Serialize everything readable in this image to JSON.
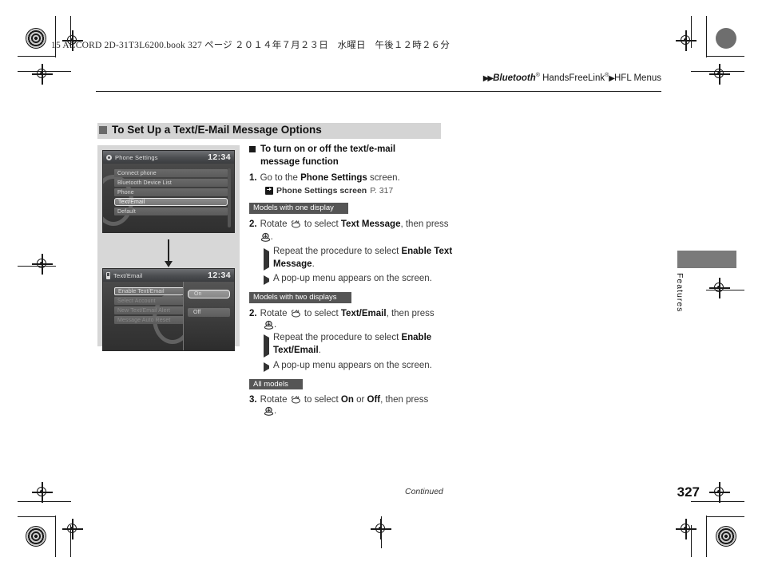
{
  "print_slug": "15 ACCORD 2D-31T3L6200.book  327 ページ  ２０１４年７月２３日　水曜日　午後１２時２６分",
  "breadcrumb": {
    "arrows": "▶▶",
    "item1": "Bluetooth",
    "sup1": "®",
    "item2": "HandsFreeLink",
    "sup2": "®",
    "arrow_mid": "▶",
    "item3": "HFL Menus"
  },
  "section": {
    "title": "To Set Up a Text/E-Mail Message Options"
  },
  "screens": [
    {
      "title": "Phone Settings",
      "icon": "gear-icon",
      "clock": "12:34",
      "items": [
        {
          "label": "Connect phone",
          "state": "normal"
        },
        {
          "label": "Bluetooth Device List",
          "state": "normal"
        },
        {
          "label": "Phone",
          "state": "normal"
        },
        {
          "label": "Text/Email",
          "state": "selected"
        },
        {
          "label": "Default",
          "state": "normal"
        }
      ]
    },
    {
      "title": "Text/Email",
      "icon": "phone-icon",
      "clock": "12:34",
      "items": [
        {
          "label": "Enable Text/Email",
          "state": "highlighted"
        },
        {
          "label": "Select Account",
          "state": "dim"
        },
        {
          "label": "New Text/Email Alert",
          "state": "dim"
        },
        {
          "label": "Message Auto Reset",
          "state": "dim"
        }
      ],
      "popup": [
        {
          "label": "On",
          "state": "selected"
        },
        {
          "label": "Off",
          "state": "normal"
        }
      ]
    }
  ],
  "instructions": {
    "subhead_line1": "To turn on or off the text/e-mail",
    "subhead_line2": "message function",
    "step1": {
      "num": "1.",
      "text_a": "Go to the ",
      "bold_a": "Phone Settings",
      "text_b": " screen."
    },
    "reference": {
      "label": "Phone Settings screen",
      "page": "P. 317"
    },
    "group_one_display": {
      "tag": "Models with one display",
      "step": {
        "num": "2.",
        "text_a": "Rotate ",
        "icon_knob": "rotary-knob-icon",
        "text_b": " to select ",
        "bold_a": "Text Message",
        "text_c": ", then press ",
        "icon_enter": "enter-button-icon",
        "text_d": "."
      },
      "bullets": [
        {
          "text_a": "Repeat the procedure to select ",
          "bold_a": "Enable Text Message",
          "text_b": "."
        },
        {
          "text_a": "A pop-up menu appears on the screen.",
          "bold_a": "",
          "text_b": ""
        }
      ]
    },
    "group_two_displays": {
      "tag": "Models with two displays",
      "step": {
        "num": "2.",
        "text_a": "Rotate ",
        "icon_knob": "rotary-knob-icon",
        "text_b": " to select ",
        "bold_a": "Text/Email",
        "text_c": ", then press ",
        "icon_enter": "enter-button-icon",
        "text_d": "."
      },
      "bullets": [
        {
          "text_a": "Repeat the procedure to select ",
          "bold_a": "Enable Text/Email",
          "text_b": "."
        },
        {
          "text_a": "A pop-up menu appears on the screen.",
          "bold_a": "",
          "text_b": ""
        }
      ]
    },
    "group_all_models": {
      "tag": "All models",
      "step": {
        "num": "3.",
        "text_a": "Rotate ",
        "icon_knob": "rotary-knob-icon",
        "text_b": " to select ",
        "bold_a": "On",
        "text_c": " or ",
        "bold_b": "Off",
        "text_d": ", then press ",
        "icon_enter": "enter-button-icon",
        "text_e": "."
      }
    }
  },
  "side_tab": {
    "label": "Features"
  },
  "footer": {
    "continued": "Continued",
    "page_number": "327"
  }
}
